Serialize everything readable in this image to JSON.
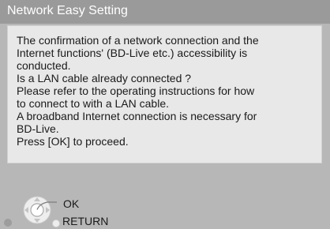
{
  "title": "Network Easy Setting",
  "message_lines": [
    "The confirmation of a network connection and the",
    "Internet functions' (BD-Live etc.) accessibility is",
    "conducted.",
    "Is a LAN cable already connected ?",
    "Please refer to the operating instructions for how",
    "to connect to with a LAN cable.",
    "A broadband Internet connection is necessary for",
    "BD-Live.",
    "Press [OK] to proceed."
  ],
  "hints": {
    "ok_label": "OK",
    "return_label": "RETURN"
  },
  "colors": {
    "background": "#b7b7b7",
    "title_bar": "#9a9a9a",
    "message_box": "#e8e8e8"
  }
}
